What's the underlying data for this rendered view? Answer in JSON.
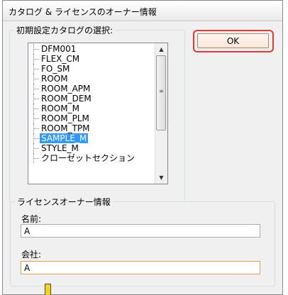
{
  "window": {
    "title": "カタログ & ライセンスのオーナー情報"
  },
  "catalog_group": {
    "legend": "初期設定カタログの選択:",
    "items": [
      {
        "label": "DFM001",
        "selected": false
      },
      {
        "label": "FLEX_CM",
        "selected": false
      },
      {
        "label": "FO_SM",
        "selected": false
      },
      {
        "label": "ROOM",
        "selected": false
      },
      {
        "label": "ROOM_APM",
        "selected": false
      },
      {
        "label": "ROOM_DEM",
        "selected": false
      },
      {
        "label": "ROOM_M",
        "selected": false
      },
      {
        "label": "ROOM_PLM",
        "selected": false
      },
      {
        "label": "ROOM_TPM",
        "selected": false
      },
      {
        "label": "SAMPLE_M",
        "selected": true
      },
      {
        "label": "STYLE_M",
        "selected": false
      },
      {
        "label": "クローゼットセクション",
        "selected": false
      }
    ],
    "scroll_up_icon": "▲",
    "scroll_down_icon": "▼"
  },
  "ok_button": {
    "label": "OK"
  },
  "license_group": {
    "legend": "ライセンスオーナー情報",
    "name_label": "名前:",
    "name_value": "A",
    "company_label": "会社:",
    "company_value": "A"
  },
  "colors": {
    "selection": "#3399ff",
    "highlight_box": "#e53935",
    "focus_border": "#e2a055"
  }
}
